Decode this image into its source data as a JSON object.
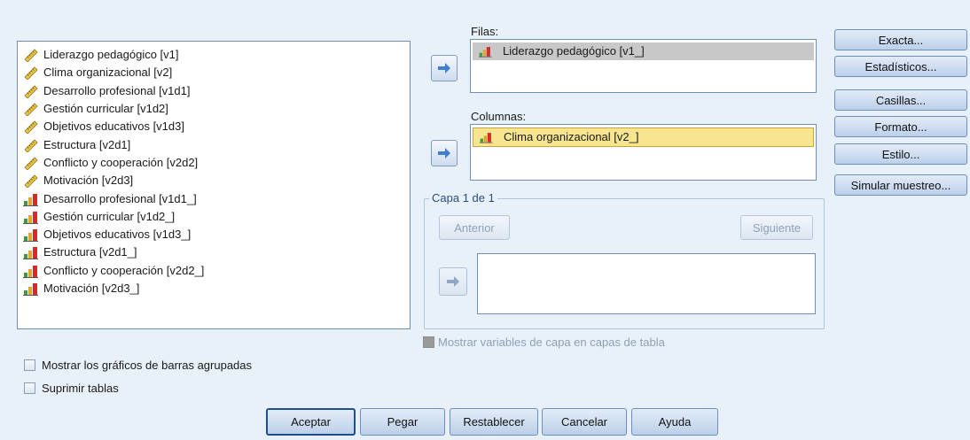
{
  "source_list": {
    "items": [
      {
        "label": "Liderazgo pedagógico [v1]",
        "icon": "scale-ruler-icon"
      },
      {
        "label": "Clima organizacional [v2]",
        "icon": "scale-ruler-icon"
      },
      {
        "label": "Desarrollo profesional [v1d1]",
        "icon": "scale-ruler-icon"
      },
      {
        "label": "Gestión curricular [v1d2]",
        "icon": "scale-ruler-icon"
      },
      {
        "label": "Objetivos educativos [v1d3]",
        "icon": "scale-ruler-icon"
      },
      {
        "label": "Estructura [v2d1]",
        "icon": "scale-ruler-icon"
      },
      {
        "label": "Conflicto y cooperación [v2d2]",
        "icon": "scale-ruler-icon"
      },
      {
        "label": "Motivación [v2d3]",
        "icon": "scale-ruler-icon"
      },
      {
        "label": "Desarrollo profesional [v1d1_]",
        "icon": "ordinal-bars-icon"
      },
      {
        "label": "Gestión curricular [v1d2_]",
        "icon": "ordinal-bars-icon"
      },
      {
        "label": "Objetivos educativos [v1d3_]",
        "icon": "ordinal-bars-icon"
      },
      {
        "label": "Estructura [v2d1_]",
        "icon": "ordinal-bars-icon"
      },
      {
        "label": "Conflicto y cooperación [v2d2_]",
        "icon": "ordinal-bars-icon"
      },
      {
        "label": "Motivación [v2d3_]",
        "icon": "ordinal-bars-icon"
      }
    ]
  },
  "rows": {
    "label": "Filas:",
    "item": "Liderazgo pedagógico [v1_]"
  },
  "columns": {
    "label": "Columnas:",
    "item": "Clima organizacional [v2_]"
  },
  "layer": {
    "title": "Capa 1 de 1",
    "prev": "Anterior",
    "next": "Siguiente"
  },
  "layer_checkbox": "Mostrar variables de capa en capas de tabla",
  "side_buttons": [
    "Exacta...",
    "Estadísticos...",
    "Casillas...",
    "Formato...",
    "Estilo...",
    "Simular muestreo..."
  ],
  "options": {
    "clustered_bars": "Mostrar los gráficos de barras agrupadas",
    "suppress_tables": "Suprimir tablas"
  },
  "bottom_buttons": [
    "Aceptar",
    "Pegar",
    "Restablecer",
    "Cancelar",
    "Ayuda"
  ],
  "colors": {
    "accent": "#3f7fd0",
    "background": "#e8f0f9",
    "selection_yellow": "#f7e58f"
  }
}
